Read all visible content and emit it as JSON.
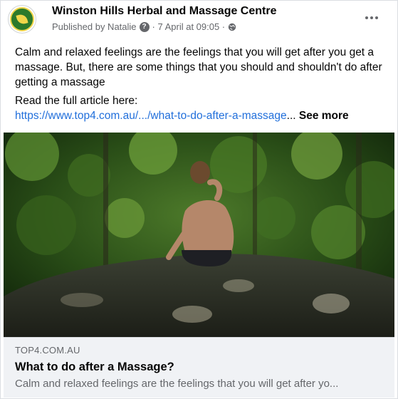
{
  "post": {
    "page_name": "Winston Hills Herbal and Massage Centre",
    "published_by": "Published by Natalie",
    "help_glyph": "?",
    "date": "· 7 April at 09:05 ·",
    "more_icon": "ellipsis-icon",
    "body": "Calm and relaxed feelings are the feelings that you will get after you get a massage. But, there are some things that you should and shouldn't do after getting a massage",
    "read_label": "Read the full article here:",
    "link_text": "https://www.top4.com.au/.../what-to-do-after-a-massage",
    "ellipsis": "...",
    "see_more": "See more"
  },
  "link_preview": {
    "domain": "TOP4.COM.AU",
    "title": "What to do after a Massage?",
    "description": "Calm and relaxed feelings are the feelings that you will get after yo..."
  },
  "colors": {
    "link": "#216fdb",
    "text": "#050505",
    "secondary": "#65676b"
  }
}
